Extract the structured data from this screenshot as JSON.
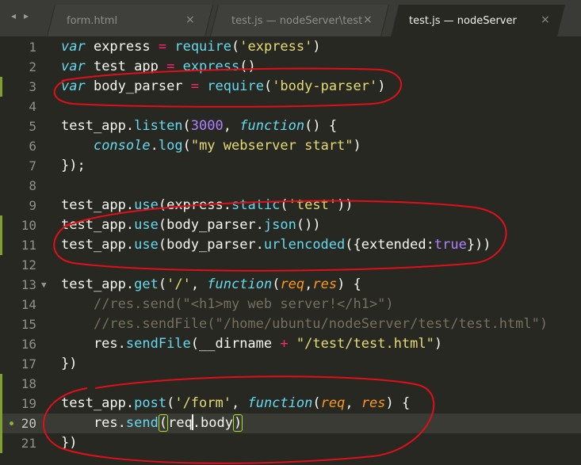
{
  "tabs": [
    {
      "label": "form.html",
      "close": "×",
      "active": false
    },
    {
      "label": "test.js — nodeServer\\test",
      "close": "×",
      "active": false
    },
    {
      "label": "test.js — nodeServer",
      "close": "×",
      "active": true
    }
  ],
  "nav": {
    "back_icon": "◂",
    "forward_icon": "▸"
  },
  "editor": {
    "current_line": 20,
    "lines": [
      {
        "n": "1",
        "tokens": [
          [
            "kw",
            "var"
          ],
          [
            "",
            "  express "
          ],
          [
            "op",
            "="
          ],
          [
            "",
            ""
          ],
          " "
        ]
      },
      {
        "n": "2"
      },
      {
        "n": "3"
      }
    ]
  },
  "colors": {
    "background": "#272822",
    "keyword": "#66d9ef",
    "string": "#e6db74",
    "number": "#ae81ff",
    "operator": "#f92672",
    "parameter": "#fd971f",
    "comment": "#75715e",
    "annotation_circle": "#e0101a"
  }
}
